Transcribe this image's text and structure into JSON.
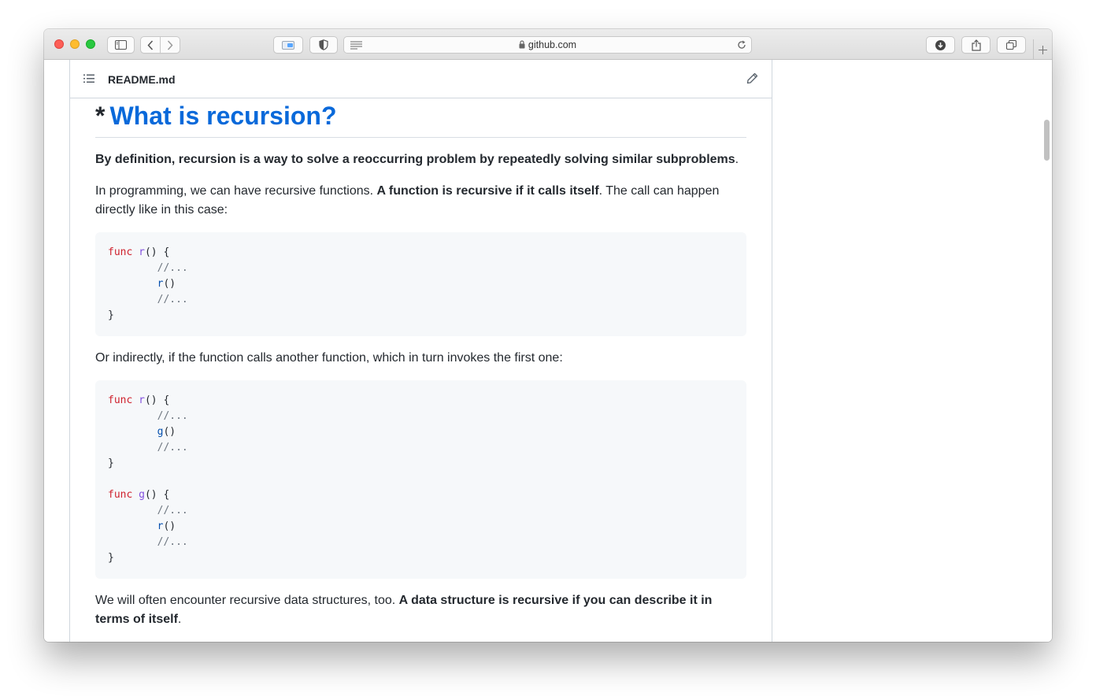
{
  "browser": {
    "url": "github.com"
  },
  "file": {
    "name": "README.md"
  },
  "readme": {
    "heading_prefix": "*",
    "heading": "What is recursion?",
    "p1_bold": "By definition, recursion is a way to solve a reoccurring problem by repeatedly solving similar subproblems",
    "p1_end": ".",
    "p2_start": "In programming, we can have recursive functions. ",
    "p2_bold": "A function is recursive if it calls itself",
    "p2_end": ". The call can happen directly like in this case:",
    "code1": [
      {
        "kw": "func",
        "fn": "r",
        "rest": "() {"
      },
      {
        "comment": "//..."
      },
      {
        "call": "r",
        "rest": "()"
      },
      {
        "comment": "//..."
      },
      {
        "close": "}"
      }
    ],
    "p3": "Or indirectly, if the function calls another function, which in turn invokes the first one:",
    "code2": [
      {
        "kw": "func",
        "fn": "r",
        "rest": "() {"
      },
      {
        "comment": "//..."
      },
      {
        "call": "g",
        "rest": "()"
      },
      {
        "comment": "//..."
      },
      {
        "close": "}"
      },
      {
        "blank": ""
      },
      {
        "kw": "func",
        "fn": "g",
        "rest": "() {"
      },
      {
        "comment": "//..."
      },
      {
        "call": "r",
        "rest": "()"
      },
      {
        "comment": "//..."
      },
      {
        "close": "}"
      }
    ],
    "p4_start": "We will often encounter recursive data structures, too. ",
    "p4_bold": "A data structure is recursive if you can describe it in terms of itself",
    "p4_end": "."
  },
  "icons": {
    "toolbar": [
      "sidebar-icon",
      "back-icon",
      "forward-icon",
      "extension-icon",
      "privacy-shield-icon",
      "reader-icon",
      "lock-icon",
      "reload-icon",
      "download-icon",
      "share-icon",
      "tabs-icon",
      "new-tab-icon"
    ],
    "file": [
      "list-icon",
      "pencil-icon"
    ]
  },
  "colors": {
    "link": "#0969da",
    "keyword": "#cf222e",
    "function_name": "#8250df",
    "comment": "#6e7781",
    "call": "#0550ae",
    "code_bg": "#f6f8fa"
  }
}
